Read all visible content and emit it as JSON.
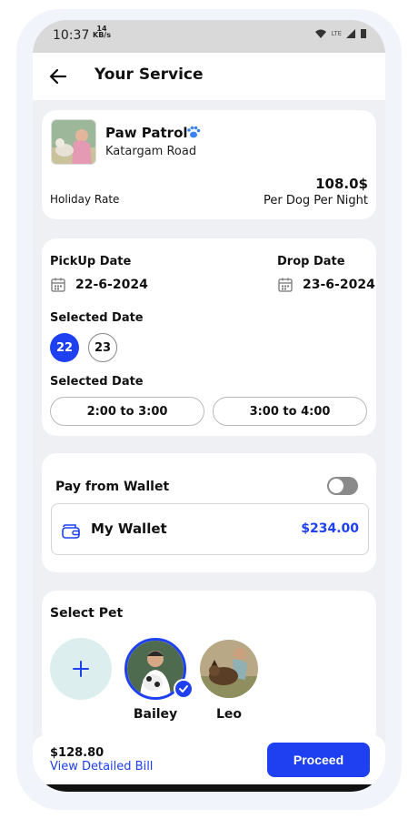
{
  "status_bar": {
    "time": "10:37",
    "speed_value": "14",
    "speed_unit": "KB/s",
    "network": "LTE"
  },
  "header": {
    "title": "Your Service"
  },
  "provider": {
    "name": "Paw Patrol",
    "location": "Katargam Road",
    "rate_label": "Holiday Rate",
    "price": "108.0$",
    "price_unit": "Per Dog Per Night"
  },
  "schedule": {
    "pickup_label": "PickUp Date",
    "pickup_date": "22-6-2024",
    "drop_label": "Drop Date",
    "drop_date": "23-6-2024",
    "selected_date_label": "Selected Date",
    "days": [
      {
        "label": "22",
        "active": true
      },
      {
        "label": "23",
        "active": false
      }
    ],
    "time_label": "Selected Date",
    "slots": [
      "2:00 to 3:00",
      "3:00 to 4:00"
    ]
  },
  "wallet": {
    "pay_label": "Pay from Wallet",
    "toggle_on": false,
    "name": "My Wallet",
    "amount": "$234.00"
  },
  "pets": {
    "title": "Select Pet",
    "items": [
      {
        "name": "Bailey",
        "selected": true
      },
      {
        "name": "Leo",
        "selected": false
      }
    ]
  },
  "footer": {
    "total": "$128.80",
    "bill_link": "View Detailed Bill",
    "proceed_label": "Proceed"
  },
  "colors": {
    "accent": "#1e40f0",
    "background": "#eef0f3",
    "card": "#ffffff",
    "add_pet_bg": "#dcefee"
  }
}
